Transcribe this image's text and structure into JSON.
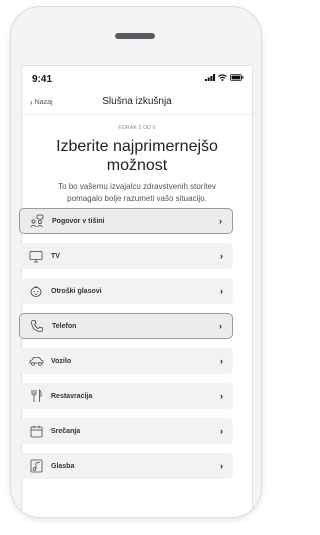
{
  "status_bar": {
    "time": "9:41"
  },
  "nav": {
    "back_label": "Nazaj",
    "title": "Slušna izkušnja"
  },
  "content": {
    "step": "KORAK 2 OD 6",
    "heading_line1": "Izberite najprimernejšo",
    "heading_line2": "možnost",
    "subtitle_line1": "To bo vašemu izvajalcu zdravstvenih storitev",
    "subtitle_line2": "pomagalo bolje razumeti vašo situacijo."
  },
  "options": [
    {
      "label": "Pogovor v tišini",
      "icon": "conversation-icon",
      "selected": true
    },
    {
      "label": "TV",
      "icon": "tv-icon",
      "selected": false
    },
    {
      "label": "Otroški glasovi",
      "icon": "child-icon",
      "selected": false
    },
    {
      "label": "Telefon",
      "icon": "phone-icon",
      "selected": true
    },
    {
      "label": "Vozilo",
      "icon": "car-icon",
      "selected": false
    },
    {
      "label": "Restavracija",
      "icon": "restaurant-icon",
      "selected": false
    },
    {
      "label": "Srečanja",
      "icon": "calendar-icon",
      "selected": false
    },
    {
      "label": "Glasba",
      "icon": "music-icon",
      "selected": false
    }
  ],
  "chevron": "›"
}
